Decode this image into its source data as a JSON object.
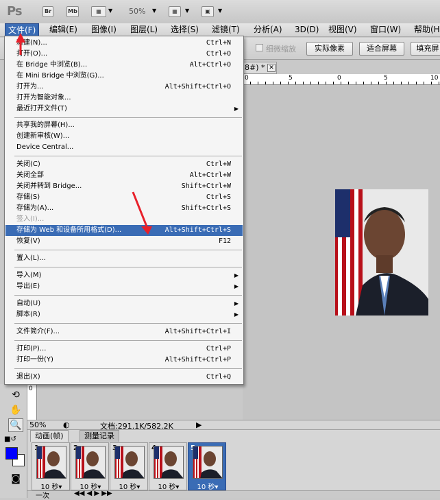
{
  "app_bar": {
    "logo": "Ps",
    "buttons": [
      "Br",
      "Mb"
    ],
    "zoom": "50%"
  },
  "menubar": {
    "items": [
      {
        "label": "文件(F)"
      },
      {
        "label": "编辑(E)"
      },
      {
        "label": "图像(I)"
      },
      {
        "label": "图层(L)"
      },
      {
        "label": "选择(S)"
      },
      {
        "label": "滤镜(T)"
      },
      {
        "label": "分析(A)"
      },
      {
        "label": "3D(D)"
      },
      {
        "label": "视图(V)"
      },
      {
        "label": "窗口(W)"
      },
      {
        "label": "帮助(H)"
      }
    ]
  },
  "options_bar": {
    "checkbox_label": "细微缩放",
    "buttons": [
      "实际像素",
      "适合屏幕",
      "填充屏"
    ]
  },
  "document": {
    "tab_label": "8#) *",
    "close": "✕"
  },
  "ruler": {
    "marks": [
      "0",
      "5",
      "10"
    ]
  },
  "status": {
    "zoom": "50%",
    "doc_info": "文档:291.1K/582.2K"
  },
  "panel": {
    "tabs": [
      "动画(帧)",
      "测量记录"
    ],
    "frames": [
      {
        "num": "1",
        "delay": "10 秒▾"
      },
      {
        "num": "2",
        "delay": "10 秒▾"
      },
      {
        "num": "3",
        "delay": "10 秒▾"
      },
      {
        "num": "4",
        "delay": "10 秒▾"
      },
      {
        "num": "5",
        "delay": "10 秒▾"
      }
    ],
    "loop": "一次"
  },
  "file_menu": {
    "items": [
      {
        "label": "新建(N)...",
        "shortcut": "Ctrl+N"
      },
      {
        "label": "打开(O)...",
        "shortcut": "Ctrl+O"
      },
      {
        "label": "在 Bridge 中浏览(B)...",
        "shortcut": "Alt+Ctrl+O"
      },
      {
        "label": "在 Mini Bridge 中浏览(G)...",
        "shortcut": ""
      },
      {
        "label": "打开为...",
        "shortcut": "Alt+Shift+Ctrl+O"
      },
      {
        "label": "打开为智能对象...",
        "shortcut": ""
      },
      {
        "label": "最近打开文件(T)",
        "shortcut": "",
        "submenu": "▶"
      },
      {
        "label": "共享我的屏幕(H)...",
        "shortcut": ""
      },
      {
        "label": "创建新审核(W)...",
        "shortcut": ""
      },
      {
        "label": "Device Central...",
        "shortcut": ""
      },
      {
        "label": "关闭(C)",
        "shortcut": "Ctrl+W"
      },
      {
        "label": "关闭全部",
        "shortcut": "Alt+Ctrl+W"
      },
      {
        "label": "关闭并转到 Bridge...",
        "shortcut": "Shift+Ctrl+W"
      },
      {
        "label": "存储(S)",
        "shortcut": "Ctrl+S"
      },
      {
        "label": "存储为(A)...",
        "shortcut": "Shift+Ctrl+S"
      },
      {
        "label": "签入(I)...",
        "shortcut": "",
        "disabled": true
      },
      {
        "label": "存储为 Web 和设备所用格式(D)...",
        "shortcut": "Alt+Shift+Ctrl+S",
        "highlight": true
      },
      {
        "label": "恢复(V)",
        "shortcut": "F12"
      },
      {
        "label": "置入(L)...",
        "shortcut": ""
      },
      {
        "label": "导入(M)",
        "shortcut": "",
        "submenu": "▶"
      },
      {
        "label": "导出(E)",
        "shortcut": "",
        "submenu": "▶"
      },
      {
        "label": "自动(U)",
        "shortcut": "",
        "submenu": "▶"
      },
      {
        "label": "脚本(R)",
        "shortcut": "",
        "submenu": "▶"
      },
      {
        "label": "文件简介(F)...",
        "shortcut": "Alt+Shift+Ctrl+I"
      },
      {
        "label": "打印(P)...",
        "shortcut": "Ctrl+P"
      },
      {
        "label": "打印一份(Y)",
        "shortcut": "Alt+Shift+Ctrl+P"
      },
      {
        "label": "退出(X)",
        "shortcut": "Ctrl+Q"
      }
    ]
  }
}
